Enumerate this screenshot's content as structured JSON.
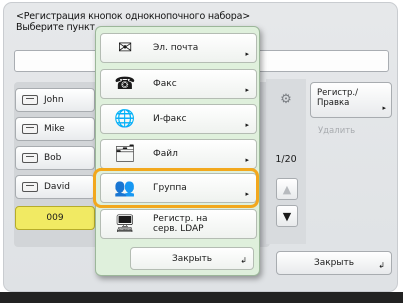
{
  "header": {
    "title": "<Регистрация кнопок однокнопочного набора>",
    "subtitle": "Выберите пункт"
  },
  "contacts": [
    {
      "label": "John"
    },
    {
      "label": "Mike"
    },
    {
      "label": "Bob"
    },
    {
      "label": "David"
    },
    {
      "label": "009"
    }
  ],
  "scroll": {
    "page": "1/20",
    "up": "▲",
    "down": "▼"
  },
  "side": {
    "register_edit": "Регистр./ Правка",
    "delete": "Удалить",
    "close": "Закрыть",
    "arrow": "▸"
  },
  "popup": {
    "items": [
      {
        "label": "Эл. почта",
        "icon": "email-icon"
      },
      {
        "label": "Факс",
        "icon": "fax-icon"
      },
      {
        "label": "И-факс",
        "icon": "ifax-icon"
      },
      {
        "label": "Файл",
        "icon": "file-icon"
      },
      {
        "label": "Группа",
        "icon": "group-icon"
      },
      {
        "label": "Регистр. на серв. LDAP",
        "icon": "ldap-icon"
      }
    ],
    "close": "Закрыть",
    "arrow": "▸"
  },
  "colors": {
    "highlight": "#f2a81d",
    "popup_bg": "#dff0dc",
    "selected_contact": "#f1ea63"
  }
}
